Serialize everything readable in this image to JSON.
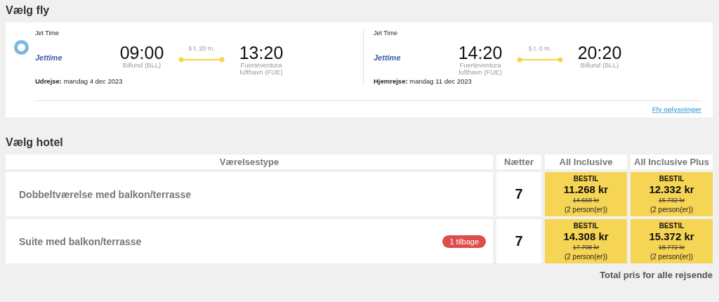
{
  "flight_section": {
    "title": "Vælg fly",
    "selected": true,
    "legs": [
      {
        "airline": "Jet Time",
        "logo": "Jettime",
        "depart_time": "09:00",
        "depart_place": "Billund (BLL)",
        "duration": "5 t. 20 m.",
        "arrive_time": "13:20",
        "arrive_place": "Fuerteventura lufthavn (FUE)",
        "date_label": "Udrejse:",
        "date": "mandag 4 dec 2023"
      },
      {
        "airline": "Jet Time",
        "logo": "Jettime",
        "depart_time": "14:20",
        "depart_place": "Fuerteventura lufthavn (FUE)",
        "duration": "5 t. 0 m.",
        "arrive_time": "20:20",
        "arrive_place": "Billund (BLL)",
        "date_label": "Hjemrejse:",
        "date": "mandag 11 dec 2023"
      }
    ],
    "details_link": "Fly oplysninger"
  },
  "hotel_section": {
    "title": "Vælg hotel",
    "columns": [
      "Værelsestype",
      "Nætter",
      "All Inclusive",
      "All Inclusive Plus"
    ],
    "rows": [
      {
        "room": "Dobbeltværelse med balkon/terrasse",
        "nights": "7",
        "offers": [
          {
            "action": "BESTIL",
            "price": "11.268 kr",
            "old_price": "14.668 kr",
            "persons": "(2 person(er))"
          },
          {
            "action": "BESTIL",
            "price": "12.332 kr",
            "old_price": "15.732 kr",
            "persons": "(2 person(er))"
          }
        ]
      },
      {
        "room": "Suite med balkon/terrasse",
        "badge": "1 tilbage",
        "nights": "7",
        "offers": [
          {
            "action": "BESTIL",
            "price": "14.308 kr",
            "old_price": "17.708 kr",
            "persons": "(2 person(er))"
          },
          {
            "action": "BESTIL",
            "price": "15.372 kr",
            "old_price": "18.772 kr",
            "persons": "(2 person(er))"
          }
        ]
      }
    ],
    "footer": "Total pris for alle rejsende"
  }
}
